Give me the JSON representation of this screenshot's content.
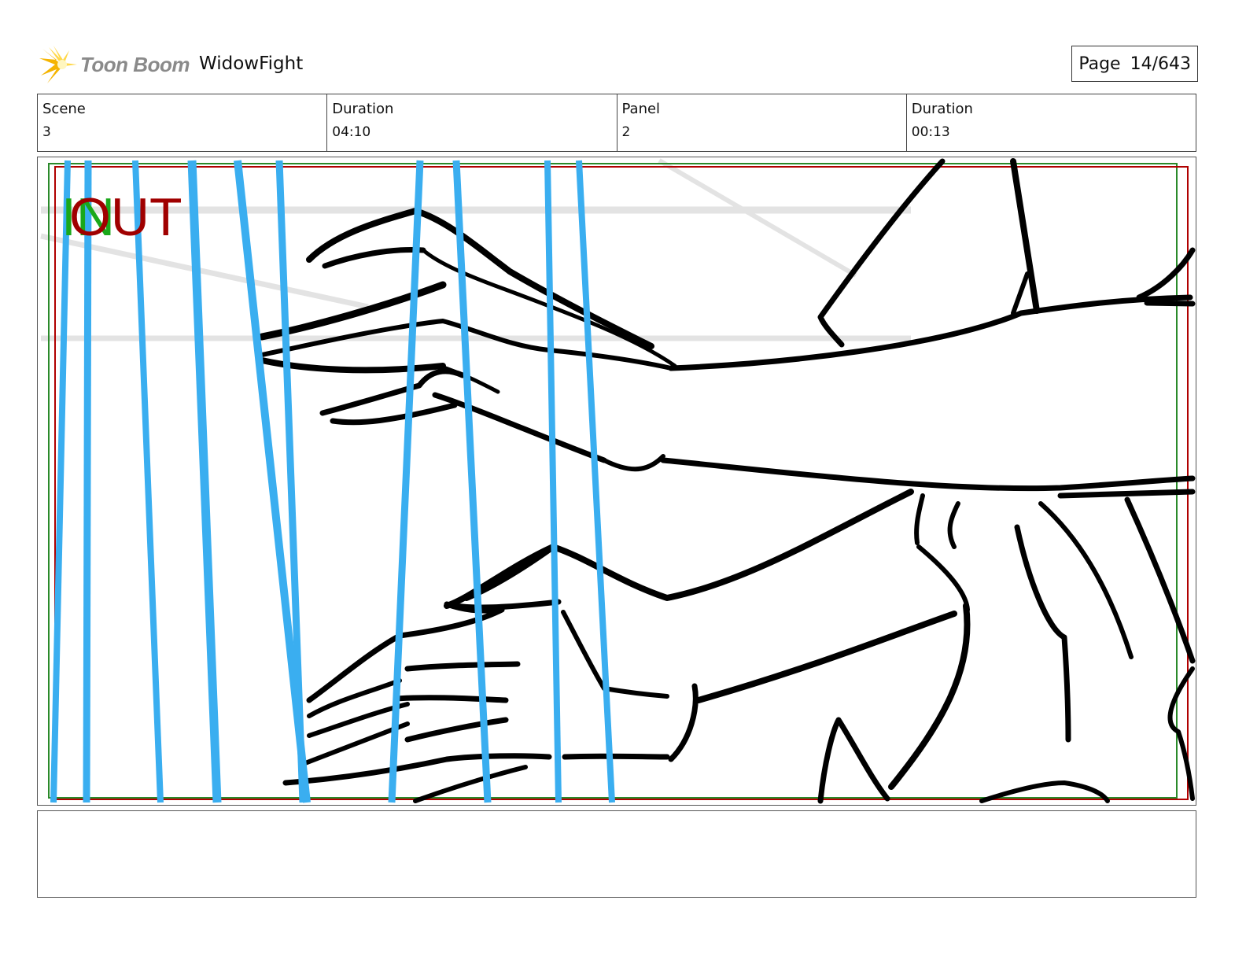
{
  "header": {
    "logo_text": "Toon Boom",
    "project_title": "WidowFight",
    "page_label": "Page",
    "page_number": "14/643"
  },
  "info": {
    "scene_label": "Scene",
    "scene_value": "3",
    "scene_duration_label": "Duration",
    "scene_duration_value": "04:10",
    "panel_label": "Panel",
    "panel_value": "2",
    "panel_duration_label": "Duration",
    "panel_duration_value": "00:13"
  },
  "panel": {
    "in_marker": "IN",
    "out_marker": "OUT",
    "colors": {
      "in_marker": "#1aa81a",
      "out_marker": "#a00000",
      "rain_lines": "#3aaef0",
      "ink": "#000000",
      "safe_frame_green": "#2a8a2a",
      "safe_frame_red": "#b00000"
    }
  },
  "notes": {
    "text": ""
  }
}
